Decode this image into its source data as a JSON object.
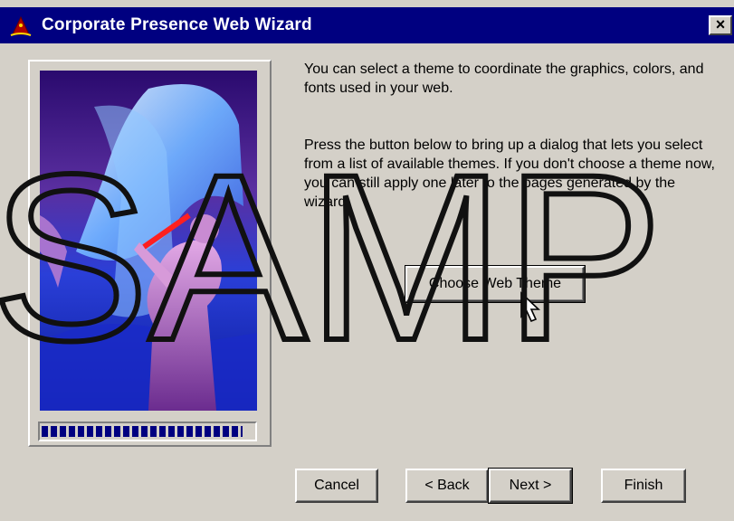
{
  "window": {
    "title": "Corporate Presence Web Wizard",
    "close_label": "×",
    "icon": "wizard-hat-icon"
  },
  "content": {
    "paragraph1": "You can select a theme to coordinate the graphics, colors, and fonts used in your web.",
    "paragraph2": "Press the button below to bring up a dialog that lets you select from a list of available themes. If you don't choose a theme now, you can still apply one later to the pages generated by the wizard.",
    "theme_button": "Choose Web Theme"
  },
  "progress": {
    "value": 0.95
  },
  "buttons": {
    "cancel": "Cancel",
    "back": "< Back",
    "next": "Next >",
    "finish": "Finish"
  },
  "watermark": "SAMP",
  "colors": {
    "titlebar": "#000080",
    "dialog": "#d4d0c8",
    "progress": "#000080"
  }
}
